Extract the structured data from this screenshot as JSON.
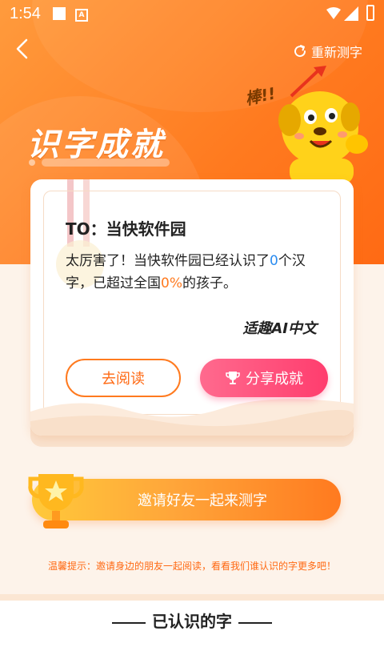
{
  "status": {
    "time": "1:54"
  },
  "header": {
    "back_icon": "chevron-left-icon",
    "retest_label": "重新测字",
    "retest_icon": "refresh-icon"
  },
  "hero": {
    "title": "识字成就",
    "mascot_exclaim": "棒!!"
  },
  "card": {
    "to_line": "TO：当快软件园",
    "message_prefix": "太厉害了！当快软件园已经认识了",
    "count": "0",
    "message_mid": "个汉字，已超过全国",
    "percent": "0%",
    "message_suffix": "的孩子。",
    "brand": "适趣AI中文",
    "read_button": "去阅读",
    "share_button": "分享成就",
    "share_icon": "trophy-icon"
  },
  "invite": {
    "label": "邀请好友一起来测字",
    "icon": "trophy-icon"
  },
  "tip": "温馨提示：邀请身边的朋友一起阅读，看看我们谁认识的字更多吧！",
  "section": {
    "title": "已认识的字"
  },
  "colors": {
    "accent": "#ff7a1f",
    "pink": "#ff3d6e",
    "blue": "#2b8cf0"
  }
}
